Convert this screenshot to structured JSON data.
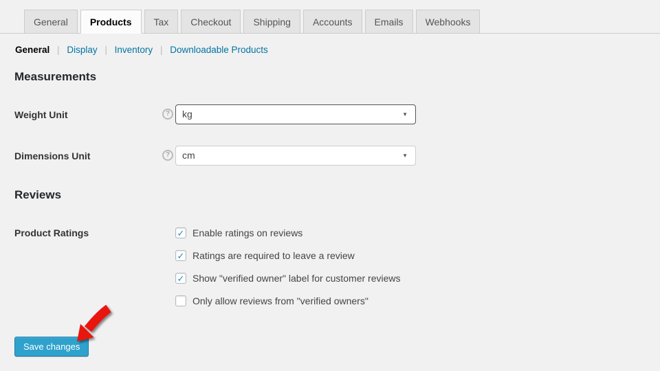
{
  "tabs": [
    {
      "label": "General",
      "active": false
    },
    {
      "label": "Products",
      "active": true
    },
    {
      "label": "Tax",
      "active": false
    },
    {
      "label": "Checkout",
      "active": false
    },
    {
      "label": "Shipping",
      "active": false
    },
    {
      "label": "Accounts",
      "active": false
    },
    {
      "label": "Emails",
      "active": false
    },
    {
      "label": "Webhooks",
      "active": false
    }
  ],
  "subnav": {
    "separator": "|",
    "items": [
      {
        "label": "General",
        "active": true
      },
      {
        "label": "Display",
        "active": false
      },
      {
        "label": "Inventory",
        "active": false
      },
      {
        "label": "Downloadable Products",
        "active": false
      }
    ]
  },
  "measurements": {
    "title": "Measurements",
    "weight_unit": {
      "label": "Weight Unit",
      "value": "kg",
      "help_icon": "?",
      "dropdown_icon": "▼"
    },
    "dimensions_unit": {
      "label": "Dimensions Unit",
      "value": "cm",
      "help_icon": "?",
      "dropdown_icon": "▼"
    }
  },
  "reviews": {
    "title": "Reviews",
    "ratings_label": "Product Ratings",
    "checkboxes": [
      {
        "label": "Enable ratings on reviews",
        "checked": true,
        "check_glyph": "✓"
      },
      {
        "label": "Ratings are required to leave a review",
        "checked": true,
        "check_glyph": "✓"
      },
      {
        "label": "Show \"verified owner\" label for customer reviews",
        "checked": true,
        "check_glyph": "✓"
      },
      {
        "label": "Only allow reviews from \"verified owners\"",
        "checked": false,
        "check_glyph": ""
      }
    ]
  },
  "footer": {
    "save_button_label": "Save changes"
  },
  "colors": {
    "page_bg": "#f1f1f1",
    "tab_bg": "#e4e4e4",
    "tab_active_bg": "#fcfcfc",
    "tab_border": "#cccccc",
    "link_blue": "#0074a2",
    "accent_blue": "#2ea2cc",
    "checkmark_blue": "#1e8cbe",
    "annotation_arrow_red": "#e8120e",
    "heading_text": "#23282d",
    "body_text": "#444444"
  }
}
